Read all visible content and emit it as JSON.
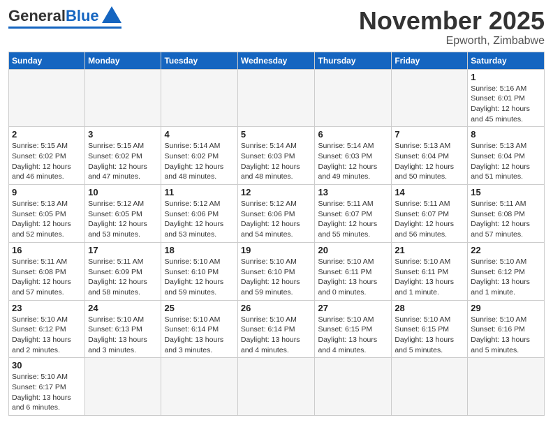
{
  "header": {
    "logo_general": "General",
    "logo_blue": "Blue",
    "month_title": "November 2025",
    "location": "Epworth, Zimbabwe"
  },
  "weekdays": [
    "Sunday",
    "Monday",
    "Tuesday",
    "Wednesday",
    "Thursday",
    "Friday",
    "Saturday"
  ],
  "days": [
    {
      "num": "",
      "info": ""
    },
    {
      "num": "",
      "info": ""
    },
    {
      "num": "",
      "info": ""
    },
    {
      "num": "",
      "info": ""
    },
    {
      "num": "",
      "info": ""
    },
    {
      "num": "",
      "info": ""
    },
    {
      "num": "1",
      "info": "Sunrise: 5:16 AM\nSunset: 6:01 PM\nDaylight: 12 hours\nand 45 minutes."
    },
    {
      "num": "2",
      "info": "Sunrise: 5:15 AM\nSunset: 6:02 PM\nDaylight: 12 hours\nand 46 minutes."
    },
    {
      "num": "3",
      "info": "Sunrise: 5:15 AM\nSunset: 6:02 PM\nDaylight: 12 hours\nand 47 minutes."
    },
    {
      "num": "4",
      "info": "Sunrise: 5:14 AM\nSunset: 6:02 PM\nDaylight: 12 hours\nand 48 minutes."
    },
    {
      "num": "5",
      "info": "Sunrise: 5:14 AM\nSunset: 6:03 PM\nDaylight: 12 hours\nand 48 minutes."
    },
    {
      "num": "6",
      "info": "Sunrise: 5:14 AM\nSunset: 6:03 PM\nDaylight: 12 hours\nand 49 minutes."
    },
    {
      "num": "7",
      "info": "Sunrise: 5:13 AM\nSunset: 6:04 PM\nDaylight: 12 hours\nand 50 minutes."
    },
    {
      "num": "8",
      "info": "Sunrise: 5:13 AM\nSunset: 6:04 PM\nDaylight: 12 hours\nand 51 minutes."
    },
    {
      "num": "9",
      "info": "Sunrise: 5:13 AM\nSunset: 6:05 PM\nDaylight: 12 hours\nand 52 minutes."
    },
    {
      "num": "10",
      "info": "Sunrise: 5:12 AM\nSunset: 6:05 PM\nDaylight: 12 hours\nand 53 minutes."
    },
    {
      "num": "11",
      "info": "Sunrise: 5:12 AM\nSunset: 6:06 PM\nDaylight: 12 hours\nand 53 minutes."
    },
    {
      "num": "12",
      "info": "Sunrise: 5:12 AM\nSunset: 6:06 PM\nDaylight: 12 hours\nand 54 minutes."
    },
    {
      "num": "13",
      "info": "Sunrise: 5:11 AM\nSunset: 6:07 PM\nDaylight: 12 hours\nand 55 minutes."
    },
    {
      "num": "14",
      "info": "Sunrise: 5:11 AM\nSunset: 6:07 PM\nDaylight: 12 hours\nand 56 minutes."
    },
    {
      "num": "15",
      "info": "Sunrise: 5:11 AM\nSunset: 6:08 PM\nDaylight: 12 hours\nand 57 minutes."
    },
    {
      "num": "16",
      "info": "Sunrise: 5:11 AM\nSunset: 6:08 PM\nDaylight: 12 hours\nand 57 minutes."
    },
    {
      "num": "17",
      "info": "Sunrise: 5:11 AM\nSunset: 6:09 PM\nDaylight: 12 hours\nand 58 minutes."
    },
    {
      "num": "18",
      "info": "Sunrise: 5:10 AM\nSunset: 6:10 PM\nDaylight: 12 hours\nand 59 minutes."
    },
    {
      "num": "19",
      "info": "Sunrise: 5:10 AM\nSunset: 6:10 PM\nDaylight: 12 hours\nand 59 minutes."
    },
    {
      "num": "20",
      "info": "Sunrise: 5:10 AM\nSunset: 6:11 PM\nDaylight: 13 hours\nand 0 minutes."
    },
    {
      "num": "21",
      "info": "Sunrise: 5:10 AM\nSunset: 6:11 PM\nDaylight: 13 hours\nand 1 minute."
    },
    {
      "num": "22",
      "info": "Sunrise: 5:10 AM\nSunset: 6:12 PM\nDaylight: 13 hours\nand 1 minute."
    },
    {
      "num": "23",
      "info": "Sunrise: 5:10 AM\nSunset: 6:12 PM\nDaylight: 13 hours\nand 2 minutes."
    },
    {
      "num": "24",
      "info": "Sunrise: 5:10 AM\nSunset: 6:13 PM\nDaylight: 13 hours\nand 3 minutes."
    },
    {
      "num": "25",
      "info": "Sunrise: 5:10 AM\nSunset: 6:14 PM\nDaylight: 13 hours\nand 3 minutes."
    },
    {
      "num": "26",
      "info": "Sunrise: 5:10 AM\nSunset: 6:14 PM\nDaylight: 13 hours\nand 4 minutes."
    },
    {
      "num": "27",
      "info": "Sunrise: 5:10 AM\nSunset: 6:15 PM\nDaylight: 13 hours\nand 4 minutes."
    },
    {
      "num": "28",
      "info": "Sunrise: 5:10 AM\nSunset: 6:15 PM\nDaylight: 13 hours\nand 5 minutes."
    },
    {
      "num": "29",
      "info": "Sunrise: 5:10 AM\nSunset: 6:16 PM\nDaylight: 13 hours\nand 5 minutes."
    },
    {
      "num": "30",
      "info": "Sunrise: 5:10 AM\nSunset: 6:17 PM\nDaylight: 13 hours\nand 6 minutes."
    },
    {
      "num": "",
      "info": ""
    },
    {
      "num": "",
      "info": ""
    },
    {
      "num": "",
      "info": ""
    },
    {
      "num": "",
      "info": ""
    },
    {
      "num": "",
      "info": ""
    },
    {
      "num": "",
      "info": ""
    }
  ]
}
